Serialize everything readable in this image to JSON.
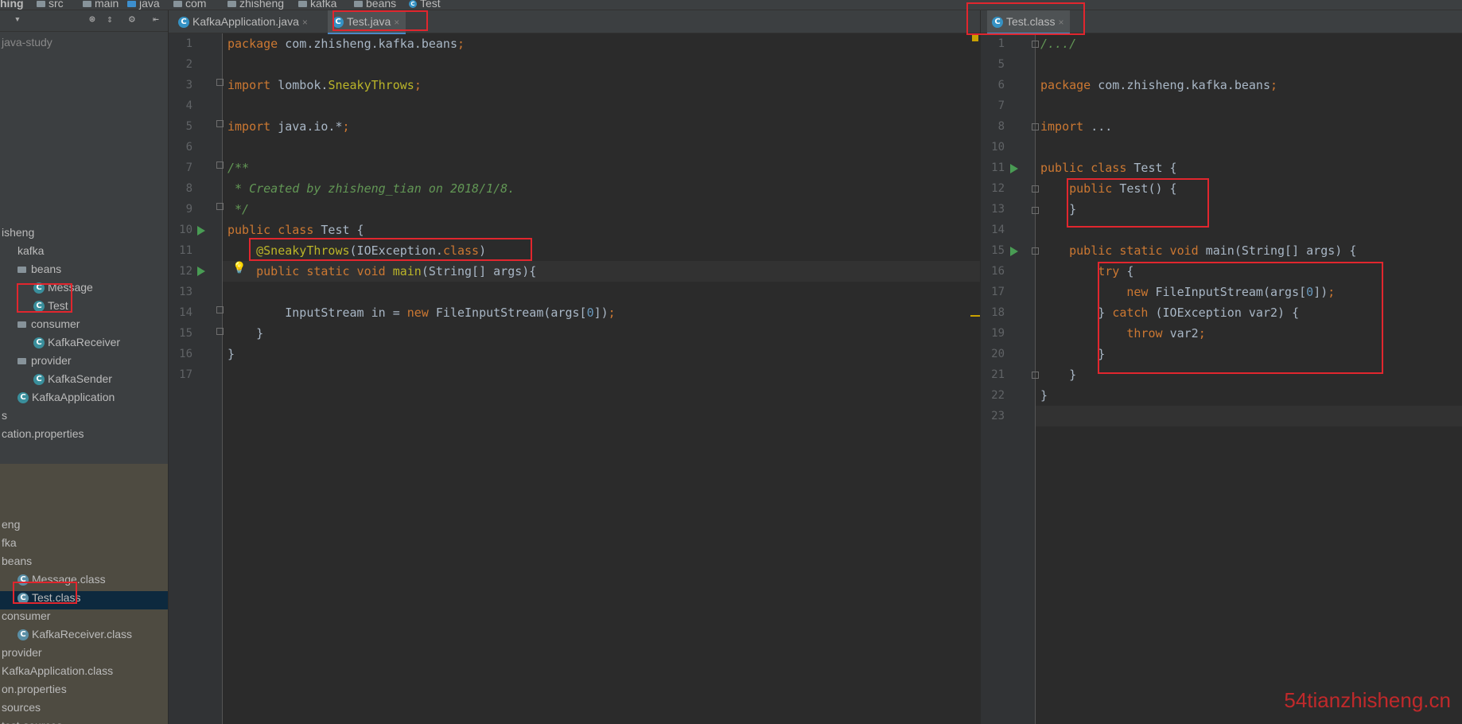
{
  "breadcrumb": [
    "hing",
    "src",
    "main",
    "java",
    "com",
    "zhisheng",
    "kafka",
    "beans",
    "Test"
  ],
  "project": {
    "root": "java-study"
  },
  "tree_top": [
    {
      "label": "isheng",
      "icon": "none",
      "indent": 0
    },
    {
      "label": "kafka",
      "icon": "none",
      "indent": 1
    },
    {
      "label": "beans",
      "icon": "folder",
      "indent": 1
    },
    {
      "label": "Message",
      "icon": "class",
      "indent": 2
    },
    {
      "label": "Test",
      "icon": "class",
      "indent": 2
    },
    {
      "label": "consumer",
      "icon": "folder",
      "indent": 1
    },
    {
      "label": "KafkaReceiver",
      "icon": "class",
      "indent": 2
    },
    {
      "label": "provider",
      "icon": "folder",
      "indent": 1
    },
    {
      "label": "KafkaSender",
      "icon": "class",
      "indent": 2
    },
    {
      "label": "KafkaApplication",
      "icon": "class",
      "indent": 1
    },
    {
      "label": "s",
      "icon": "none",
      "indent": 0
    },
    {
      "label": "cation.properties",
      "icon": "none",
      "indent": 0
    }
  ],
  "tree_bottom": [
    {
      "label": "eng",
      "icon": "none",
      "indent": 0
    },
    {
      "label": "fka",
      "icon": "none",
      "indent": 0
    },
    {
      "label": "beans",
      "icon": "none",
      "indent": 0
    },
    {
      "label": "Message.class",
      "icon": "compiled",
      "indent": 1
    },
    {
      "label": "Test.class",
      "icon": "compiled",
      "indent": 1
    },
    {
      "label": "consumer",
      "icon": "none",
      "indent": 0
    },
    {
      "label": "KafkaReceiver.class",
      "icon": "compiled",
      "indent": 1
    },
    {
      "label": "provider",
      "icon": "none",
      "indent": 0
    },
    {
      "label": "KafkaApplication.class",
      "icon": "none",
      "indent": 0
    },
    {
      "label": "on.properties",
      "icon": "none",
      "indent": 0
    },
    {
      "label": "sources",
      "icon": "none",
      "indent": 0
    },
    {
      "label": "test-sources",
      "icon": "none",
      "indent": 0
    }
  ],
  "left_tabs": [
    {
      "label": "KafkaApplication.java",
      "close": "×"
    },
    {
      "label": "Test.java",
      "close": "×"
    }
  ],
  "right_tabs": [
    {
      "label": "Test.class",
      "close": "×"
    }
  ],
  "left_editor": {
    "line_numbers": [
      "1",
      "2",
      "3",
      "4",
      "5",
      "6",
      "7",
      "8",
      "9",
      "10",
      "11",
      "12",
      "13",
      "14",
      "15",
      "16",
      "17"
    ],
    "lines": [
      [
        {
          "t": "package ",
          "c": "kw"
        },
        {
          "t": "com.zhisheng.kafka.beans",
          "c": ""
        },
        {
          "t": ";",
          "c": "kw"
        }
      ],
      [],
      [
        {
          "t": "import ",
          "c": "kw"
        },
        {
          "t": "lombok.",
          "c": ""
        },
        {
          "t": "SneakyThrows",
          "c": "ann"
        },
        {
          "t": ";",
          "c": "kw"
        }
      ],
      [],
      [
        {
          "t": "import ",
          "c": "kw"
        },
        {
          "t": "java.io.*",
          "c": ""
        },
        {
          "t": ";",
          "c": "kw"
        }
      ],
      [],
      [
        {
          "t": "/**",
          "c": "cm"
        }
      ],
      [
        {
          "t": " * Created by zhisheng_tian on 2018/1/8.",
          "c": "cm"
        }
      ],
      [
        {
          "t": " */",
          "c": "cm"
        }
      ],
      [
        {
          "t": "public class ",
          "c": "kw"
        },
        {
          "t": "Test {",
          "c": ""
        }
      ],
      [
        {
          "t": "    ",
          "c": ""
        },
        {
          "t": "@SneakyThrows",
          "c": "ann"
        },
        {
          "t": "(IOException.",
          "c": ""
        },
        {
          "t": "class",
          "c": "kw"
        },
        {
          "t": ")",
          "c": ""
        }
      ],
      [
        {
          "t": "    ",
          "c": ""
        },
        {
          "t": "public static void ",
          "c": "kw"
        },
        {
          "t": "main",
          "c": "ann"
        },
        {
          "t": "(String[] args){",
          "c": ""
        }
      ],
      [],
      [
        {
          "t": "        InputStream in = ",
          "c": ""
        },
        {
          "t": "new ",
          "c": "kw"
        },
        {
          "t": "FileInputStream(args[",
          "c": ""
        },
        {
          "t": "0",
          "c": "num"
        },
        {
          "t": "])",
          "c": ""
        },
        {
          "t": ";",
          "c": "kw"
        }
      ],
      [
        {
          "t": "    }",
          "c": ""
        }
      ],
      [
        {
          "t": "}",
          "c": ""
        }
      ],
      []
    ]
  },
  "right_editor": {
    "line_numbers": [
      "1",
      "5",
      "6",
      "7",
      "8",
      "10",
      "11",
      "12",
      "13",
      "14",
      "15",
      "16",
      "17",
      "18",
      "19",
      "20",
      "21",
      "22",
      "23"
    ],
    "lines": [
      [
        {
          "t": "/.../",
          "c": "cm"
        }
      ],
      [],
      [
        {
          "t": "package ",
          "c": "kw"
        },
        {
          "t": "com.zhisheng.kafka.beans",
          "c": ""
        },
        {
          "t": ";",
          "c": "kw"
        }
      ],
      [],
      [
        {
          "t": "import ",
          "c": "kw"
        },
        {
          "t": "...",
          "c": ""
        }
      ],
      [],
      [
        {
          "t": "public class ",
          "c": "kw"
        },
        {
          "t": "Test {",
          "c": ""
        }
      ],
      [
        {
          "t": "    ",
          "c": ""
        },
        {
          "t": "public ",
          "c": "kw"
        },
        {
          "t": "Test() {",
          "c": ""
        }
      ],
      [
        {
          "t": "    }",
          "c": ""
        }
      ],
      [],
      [
        {
          "t": "    ",
          "c": ""
        },
        {
          "t": "public static void ",
          "c": "kw"
        },
        {
          "t": "main(String[] args) {",
          "c": ""
        }
      ],
      [
        {
          "t": "        ",
          "c": ""
        },
        {
          "t": "try ",
          "c": "kw"
        },
        {
          "t": "{",
          "c": ""
        }
      ],
      [
        {
          "t": "            ",
          "c": ""
        },
        {
          "t": "new ",
          "c": "kw"
        },
        {
          "t": "FileInputStream(args[",
          "c": ""
        },
        {
          "t": "0",
          "c": "num"
        },
        {
          "t": "])",
          "c": ""
        },
        {
          "t": ";",
          "c": "kw"
        }
      ],
      [
        {
          "t": "        } ",
          "c": ""
        },
        {
          "t": "catch ",
          "c": "kw"
        },
        {
          "t": "(IOException var2) {",
          "c": ""
        }
      ],
      [
        {
          "t": "            ",
          "c": ""
        },
        {
          "t": "throw ",
          "c": "kw"
        },
        {
          "t": "var2",
          "c": ""
        },
        {
          "t": ";",
          "c": "kw"
        }
      ],
      [
        {
          "t": "        }",
          "c": ""
        }
      ],
      [
        {
          "t": "    }",
          "c": ""
        }
      ],
      [
        {
          "t": "}",
          "c": ""
        }
      ],
      []
    ]
  },
  "watermark": "54tianzhisheng.cn",
  "colors": {
    "keyword": "#cc7832",
    "comment": "#629755",
    "annotation": "#bbb529",
    "number": "#6897bb",
    "highlight": "#e1262e"
  }
}
